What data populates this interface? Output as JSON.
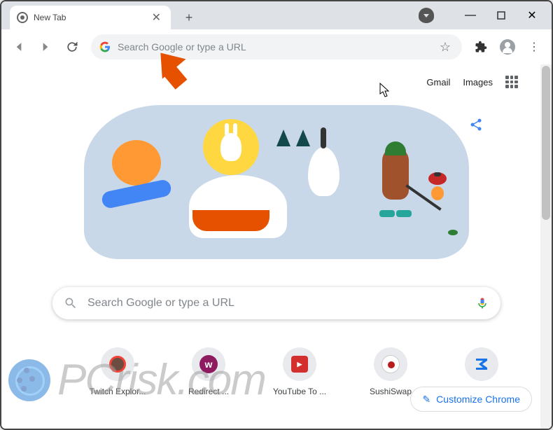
{
  "window": {
    "tab_title": "New Tab",
    "minimize_glyph": "—",
    "maximize_glyph": "▢",
    "close_glyph": "✕"
  },
  "toolbar": {
    "omnibox_placeholder": "Search Google or type a URL",
    "new_tab_plus": "+",
    "tab_close": "✕",
    "menu_glyph": "⋮",
    "extension_glyph": "✦",
    "star_glyph": "☆"
  },
  "header": {
    "gmail": "Gmail",
    "images": "Images"
  },
  "searchbox": {
    "placeholder": "Search Google or type a URL"
  },
  "shortcuts": [
    {
      "label": "Twitch Explor...",
      "letter": ""
    },
    {
      "label": "Redirect ...",
      "letter": "w"
    },
    {
      "label": "YouTube To ...",
      "letter": "▶"
    },
    {
      "label": "SushiSwap",
      "letter": ""
    },
    {
      "label": "",
      "letter": ""
    }
  ],
  "customize": {
    "label": "Customize Chrome",
    "pencil": "✎"
  },
  "watermark": {
    "text": "PCrisk.com"
  }
}
